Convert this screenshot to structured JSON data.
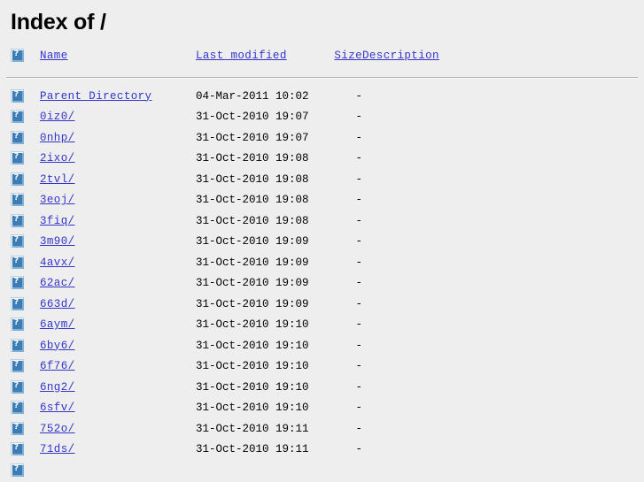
{
  "page": {
    "title": "Index of /",
    "background_color": "#eeeeee",
    "link_color": "#3434cc",
    "text_color": "#000000",
    "rule_color": "#adadad"
  },
  "table": {
    "columns": [
      {
        "key": "icon",
        "label": ""
      },
      {
        "key": "name",
        "label": "Name"
      },
      {
        "key": "date",
        "label": "Last modified"
      },
      {
        "key": "size",
        "label": "Size"
      },
      {
        "key": "desc",
        "label": "Description"
      }
    ],
    "header_icon": "broken-image-icon",
    "rows": [
      {
        "icon": "broken-image-icon",
        "name": "Parent Directory",
        "date": "04-Mar-2011 10:02",
        "size": "-",
        "desc": ""
      },
      {
        "icon": "broken-image-icon",
        "name": "0iz0/",
        "date": "31-Oct-2010 19:07",
        "size": "-",
        "desc": ""
      },
      {
        "icon": "broken-image-icon",
        "name": "0nhp/",
        "date": "31-Oct-2010 19:07",
        "size": "-",
        "desc": ""
      },
      {
        "icon": "broken-image-icon",
        "name": "2ixo/",
        "date": "31-Oct-2010 19:08",
        "size": "-",
        "desc": ""
      },
      {
        "icon": "broken-image-icon",
        "name": "2tvl/",
        "date": "31-Oct-2010 19:08",
        "size": "-",
        "desc": ""
      },
      {
        "icon": "broken-image-icon",
        "name": "3eoj/",
        "date": "31-Oct-2010 19:08",
        "size": "-",
        "desc": ""
      },
      {
        "icon": "broken-image-icon",
        "name": "3fiq/",
        "date": "31-Oct-2010 19:08",
        "size": "-",
        "desc": ""
      },
      {
        "icon": "broken-image-icon",
        "name": "3m90/",
        "date": "31-Oct-2010 19:09",
        "size": "-",
        "desc": ""
      },
      {
        "icon": "broken-image-icon",
        "name": "4avx/",
        "date": "31-Oct-2010 19:09",
        "size": "-",
        "desc": ""
      },
      {
        "icon": "broken-image-icon",
        "name": "62ac/",
        "date": "31-Oct-2010 19:09",
        "size": "-",
        "desc": ""
      },
      {
        "icon": "broken-image-icon",
        "name": "663d/",
        "date": "31-Oct-2010 19:09",
        "size": "-",
        "desc": ""
      },
      {
        "icon": "broken-image-icon",
        "name": "6aym/",
        "date": "31-Oct-2010 19:10",
        "size": "-",
        "desc": ""
      },
      {
        "icon": "broken-image-icon",
        "name": "6by6/",
        "date": "31-Oct-2010 19:10",
        "size": "-",
        "desc": ""
      },
      {
        "icon": "broken-image-icon",
        "name": "6f76/",
        "date": "31-Oct-2010 19:10",
        "size": "-",
        "desc": ""
      },
      {
        "icon": "broken-image-icon",
        "name": "6ng2/",
        "date": "31-Oct-2010 19:10",
        "size": "-",
        "desc": ""
      },
      {
        "icon": "broken-image-icon",
        "name": "6sfv/",
        "date": "31-Oct-2010 19:10",
        "size": "-",
        "desc": ""
      },
      {
        "icon": "broken-image-icon",
        "name": "752o/",
        "date": "31-Oct-2010 19:11",
        "size": "-",
        "desc": ""
      },
      {
        "icon": "broken-image-icon",
        "name": "71ds/",
        "date": "31-Oct-2010 19:11",
        "size": "-",
        "desc": ""
      },
      {
        "icon": "broken-image-icon",
        "name": "",
        "date": "",
        "size": "",
        "desc": ""
      }
    ]
  }
}
